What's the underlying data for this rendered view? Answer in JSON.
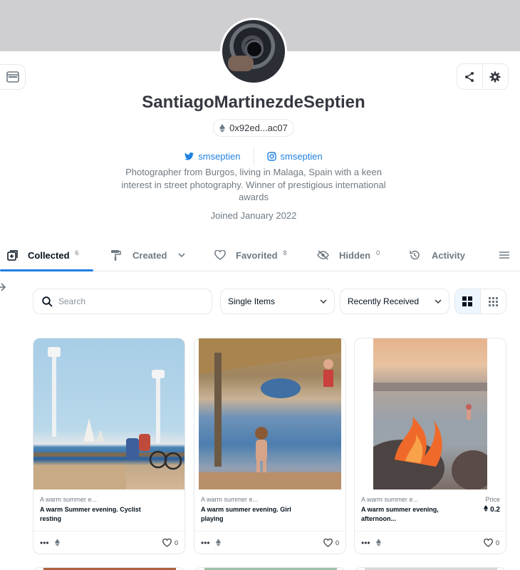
{
  "profile": {
    "name": "SantiagoMartinezdeSeptien",
    "address": "0x92ed...ac07",
    "twitter": "smseptien",
    "instagram": "smseptien",
    "bio": "Photographer from Burgos, living in Malaga, Spain with a keen interest in street photography. Winner of prestigious international awards",
    "joined": "Joined January 2022"
  },
  "tabs": [
    {
      "label": "Collected",
      "count": "6",
      "active": true
    },
    {
      "label": "Created",
      "count": ""
    },
    {
      "label": "Favorited",
      "count": "8"
    },
    {
      "label": "Hidden",
      "count": "0"
    },
    {
      "label": "Activity",
      "count": ""
    }
  ],
  "filters": {
    "search_placeholder": "Search",
    "items_select": "Single Items",
    "sort_select": "Recently Received"
  },
  "cards": [
    {
      "collection": "A warm summer e...",
      "title": "A warm Summer evening. Cyclist resting",
      "price_label": "",
      "price": "",
      "favorites": "0"
    },
    {
      "collection": "A warm summer e...",
      "title": "A warm summer evening. Girl playing",
      "price_label": "",
      "price": "",
      "favorites": "0"
    },
    {
      "collection": "A warm summer e...",
      "title": "A warm summer evening, afternoon...",
      "price_label": "Price",
      "price": "0.2",
      "favorites": "0"
    }
  ],
  "colors": {
    "accent": "#2081e2",
    "muted": "#707a83",
    "banner": "#cfcfd1"
  }
}
